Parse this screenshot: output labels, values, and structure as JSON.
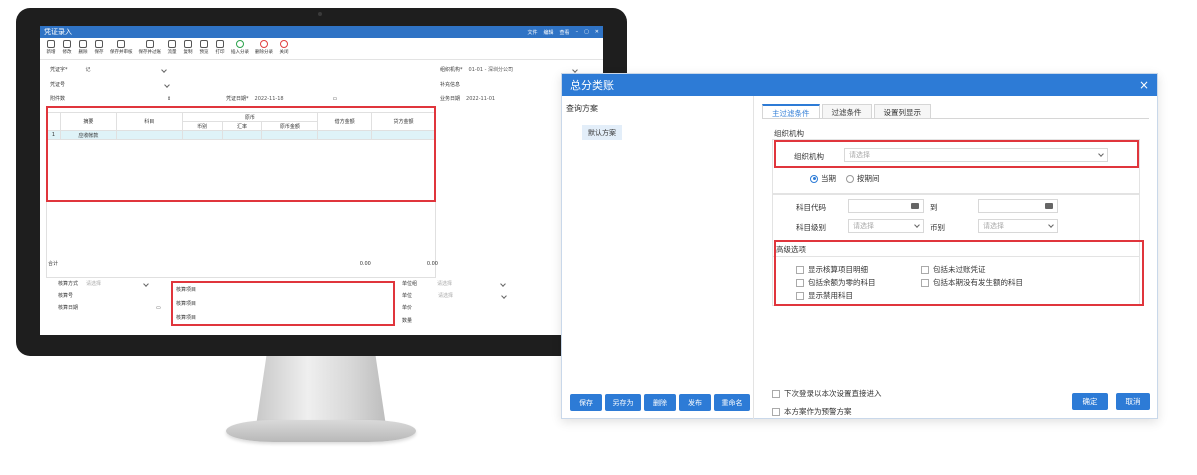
{
  "inner_app": {
    "title": "凭证录入",
    "top_menu": [
      "文件",
      "编辑",
      "查看"
    ],
    "toolbar": [
      "新增",
      "修改",
      "删除",
      "保存",
      "保存并审核",
      "保存并过账",
      "流量",
      "复制",
      "预览",
      "打印",
      "插入分录",
      "删除分录",
      "关闭"
    ],
    "fields": {
      "voucher_word_label": "凭证字*",
      "voucher_word_value": "记",
      "voucher_no_label": "凭证号",
      "attachments_label": "附件数",
      "voucher_date_label": "凭证日期*",
      "voucher_date_value": "2022-11-18",
      "org_label": "组织机构*",
      "org_value": "01-01 - 深圳分公司",
      "supp_info_label": "补充信息",
      "biz_date_label": "业务日期",
      "biz_date_value": "2022-11-01"
    },
    "grid": {
      "col_summary": "摘要",
      "col_account": "科目",
      "col_orig_group": "原币",
      "col_currency": "币别",
      "col_rate": "汇率",
      "col_orig_amount": "原币金额",
      "col_debit": "借方金额",
      "col_credit": "贷方金额",
      "row1_no": "1",
      "row1_summary": "应收帐款",
      "total_label": "合计",
      "total_debit": "0.00",
      "total_credit": "0.00"
    },
    "footer": {
      "calc_method_label": "核算方式",
      "calc_method_placeholder": "请选择",
      "calc_no_label": "核算号",
      "calc_date_label": "核算日期",
      "item1": "核算项目",
      "item2": "核算项目",
      "item3": "核算项目",
      "unit_group_label": "单位组",
      "unit_label": "单位",
      "unit_price_label": "单价",
      "quantity_label": "数量",
      "select_placeholder": "请选择"
    }
  },
  "dialog": {
    "title": "总分类账",
    "close": "×",
    "left": {
      "title": "查询方案",
      "default_scheme": "默认方案",
      "buttons": [
        "保存",
        "另存为",
        "删除",
        "发布",
        "重命名"
      ]
    },
    "tabs": [
      "主过滤条件",
      "过滤条件",
      "设置列显示"
    ],
    "org_section": "组织机构",
    "org_label": "组织机构",
    "org_placeholder": "请选择",
    "radio_current": "当期",
    "radio_period": "按期间",
    "account_code_label": "科目代码",
    "to_label": "到",
    "account_level_label": "科目级别",
    "account_level_placeholder": "请选择",
    "currency_label": "币别",
    "currency_placeholder": "请选择",
    "advanced_section": "高级选项",
    "checks": {
      "show_detail": "显示核算项目明细",
      "include_unposted": "包括未过账凭证",
      "include_zero_balance": "包括余额为零的科目",
      "include_no_occurrence": "包括本期没有发生额的科目",
      "show_disabled": "显示禁用科目"
    },
    "bottom_checks": {
      "next_login": "下次登录以本次设置直接进入",
      "warn_scheme": "本方案作为预警方案"
    },
    "ok_button": "确定",
    "cancel_button": "取消"
  }
}
